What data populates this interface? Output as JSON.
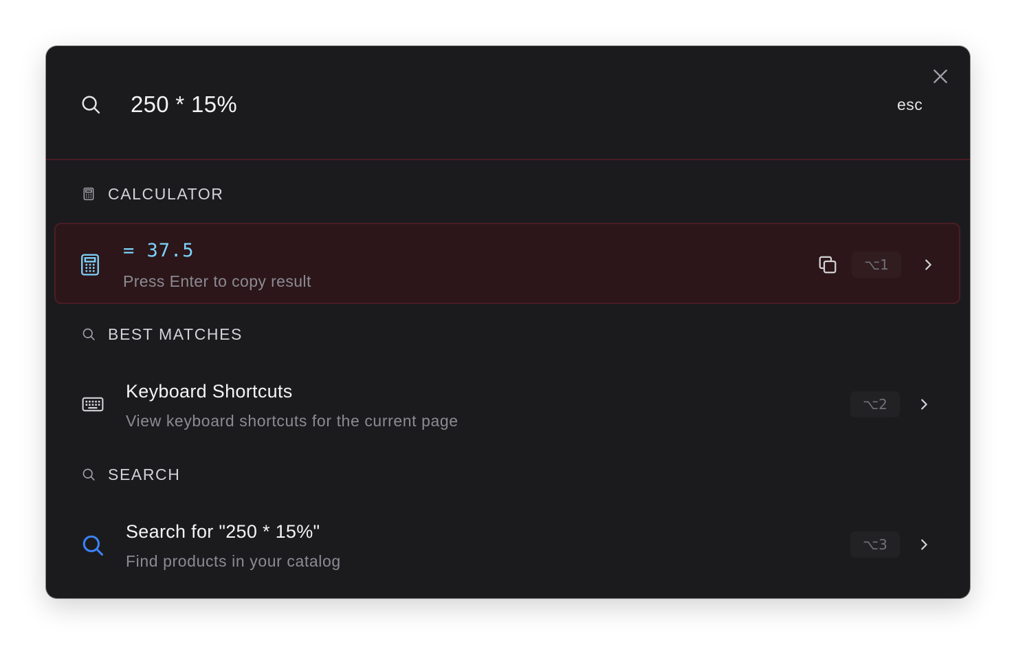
{
  "search": {
    "query": "250 * 15%",
    "esc_label": "esc"
  },
  "sections": {
    "calculator": "CALCULATOR",
    "best_matches": "BEST MATCHES",
    "search": "SEARCH"
  },
  "calculator": {
    "result": "= 37.5",
    "hint": "Press Enter to copy result",
    "shortcut": "⌥1"
  },
  "best_matches": [
    {
      "title": "Keyboard Shortcuts",
      "subtitle": "View keyboard shortcuts for the current page",
      "shortcut": "⌥2",
      "icon": "keyboard-icon"
    }
  ],
  "search_results": [
    {
      "title": "Search for \"250 * 15%\"",
      "subtitle": "Find products in your catalog",
      "shortcut": "⌥3",
      "icon": "search-icon"
    }
  ],
  "colors": {
    "accent_cyan": "#7dd3fc",
    "accent_blue": "#3b82f6",
    "selected_bg": "#2c1619",
    "selected_border": "#4b1d25",
    "panel_bg": "#1b1b1e"
  }
}
